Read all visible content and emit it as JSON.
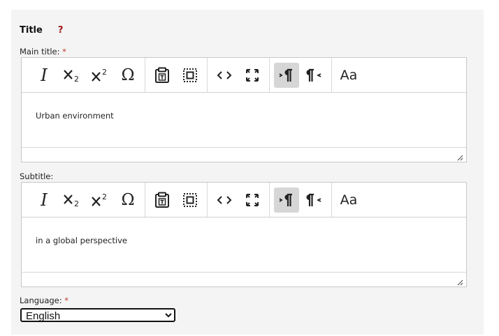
{
  "section": {
    "title": "Title",
    "help": "?"
  },
  "main_title": {
    "label": "Main title:",
    "required": "*",
    "content": "Urban environment"
  },
  "subtitle": {
    "label": "Subtitle:",
    "content": "in a global perspective"
  },
  "language": {
    "label": "Language:",
    "required": "*",
    "selected": "English"
  },
  "toolbar": {
    "italic": "I",
    "omega": "Ω",
    "case": "Aa",
    "icons": [
      "italic-icon",
      "subscript-icon",
      "superscript-icon",
      "special-character-icon",
      "paste-text-icon",
      "select-all-icon",
      "source-code-icon",
      "fullscreen-icon",
      "left-to-right-icon",
      "right-to-left-icon",
      "change-case-icon"
    ]
  }
}
